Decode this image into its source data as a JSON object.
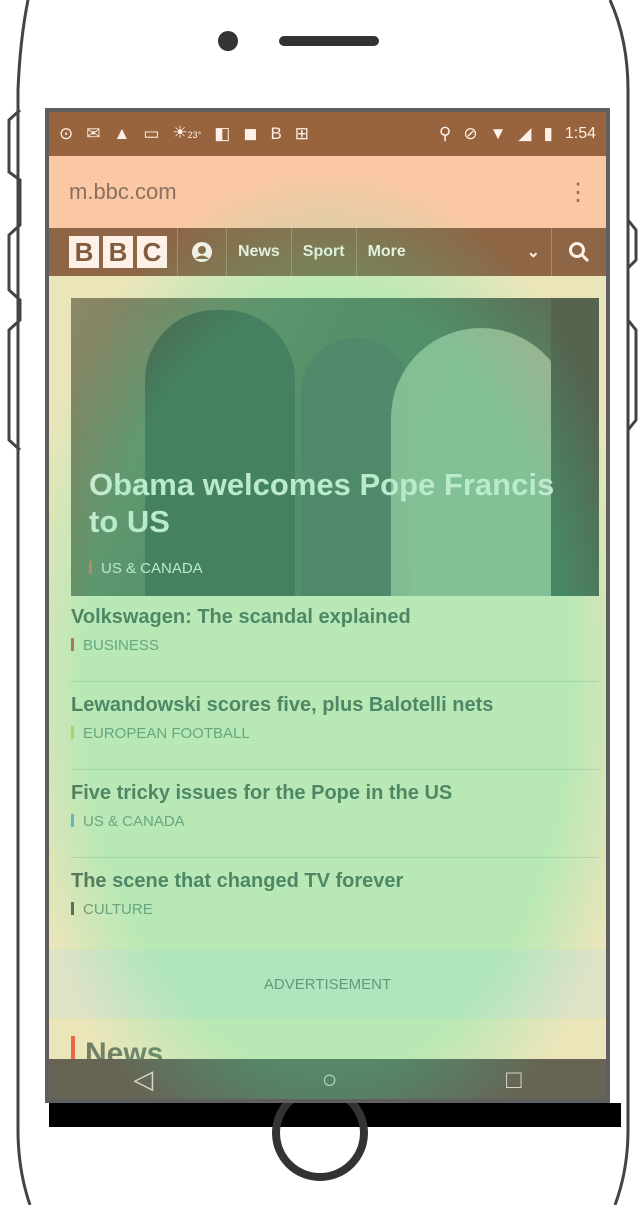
{
  "status_bar": {
    "icons": [
      "voicemail-icon",
      "gmail-icon",
      "warning-icon",
      "image-icon",
      "weather-icon",
      "keep-icon",
      "notes-icon",
      "b-icon",
      "download-icon"
    ],
    "weather_temp": "23°",
    "right_icons": [
      "location-icon",
      "block-icon",
      "wifi-icon",
      "signal-icon",
      "battery-icon"
    ],
    "time": "1:54"
  },
  "browser": {
    "url": "m.bbc.com",
    "menu_label": "⋮"
  },
  "nav": {
    "logo_letters": [
      "B",
      "B",
      "C"
    ],
    "items": [
      "News",
      "Sport",
      "More"
    ],
    "more_caret": "⌄",
    "search_icon": "⚲"
  },
  "hero": {
    "title": "Obama welcomes Pope Francis to US",
    "category": "US & CANADA"
  },
  "stories": [
    {
      "title": "Volkswagen: The scandal explained",
      "category": "BUSINESS",
      "color": "#c0392b"
    },
    {
      "title": "Lewandowski scores five, plus Balotelli nets",
      "category": "EUROPEAN FOOTBALL",
      "color": "#b7d63a"
    },
    {
      "title": "Five tricky issues for the Pope in the US",
      "category": "US & CANADA",
      "color": "#4aa8d6"
    },
    {
      "title": "The scene that changed TV forever",
      "category": "CULTURE",
      "color": "#2f4a3a"
    }
  ],
  "advertisement_label": "ADVERTISEMENT",
  "section": {
    "title": "News",
    "bar_color": "#e0502d"
  },
  "android_nav": {
    "back_icon": "◁",
    "home_icon": "○",
    "recents_icon": "□"
  },
  "colors": {
    "status_bar": "#7a4a24",
    "url_bar": "#f8cba9",
    "nav_bar": "#6e4d2f",
    "heatmap_green": "#78dca0"
  }
}
